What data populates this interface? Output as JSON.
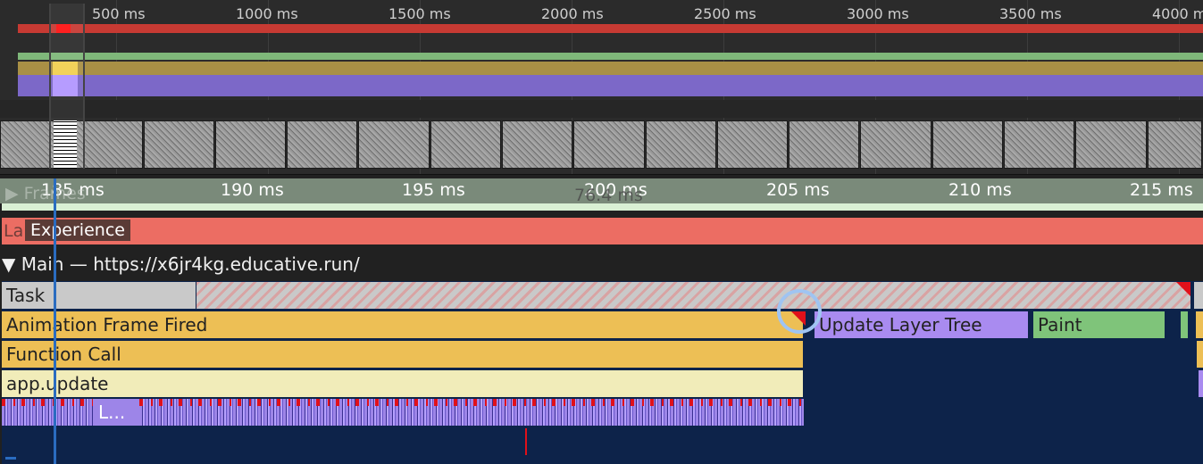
{
  "overview": {
    "ticks": [
      "500 ms",
      "1000 ms",
      "1500 ms",
      "2000 ms",
      "2500 ms",
      "3000 ms",
      "3500 ms",
      "4000 ms"
    ]
  },
  "ruler": {
    "ticks": [
      "185 ms",
      "190 ms",
      "195 ms",
      "200 ms",
      "205 ms",
      "210 ms",
      "215 ms"
    ]
  },
  "tracks": {
    "frames_label": "Frames",
    "frame_duration": "76.4 ms",
    "experience_label": "Experience",
    "experience_ghost": "La",
    "main_header": "▼ Main — https://x6jr4kg.educative.run/"
  },
  "events": {
    "task": "Task",
    "animation_frame_fired": "Animation Frame Fired",
    "update_layer_tree": "Update Layer Tree",
    "paint": "Paint",
    "function_call": "Function Call",
    "app_update": "app.update",
    "micro_label": "L..."
  },
  "colors": {
    "task": "#c9c9c9",
    "scripting": "#edbf55",
    "rendering": "#a98bf0",
    "painting": "#7fc47a",
    "long_task_marker": "#e0101a",
    "experience": "#ec6d63"
  }
}
